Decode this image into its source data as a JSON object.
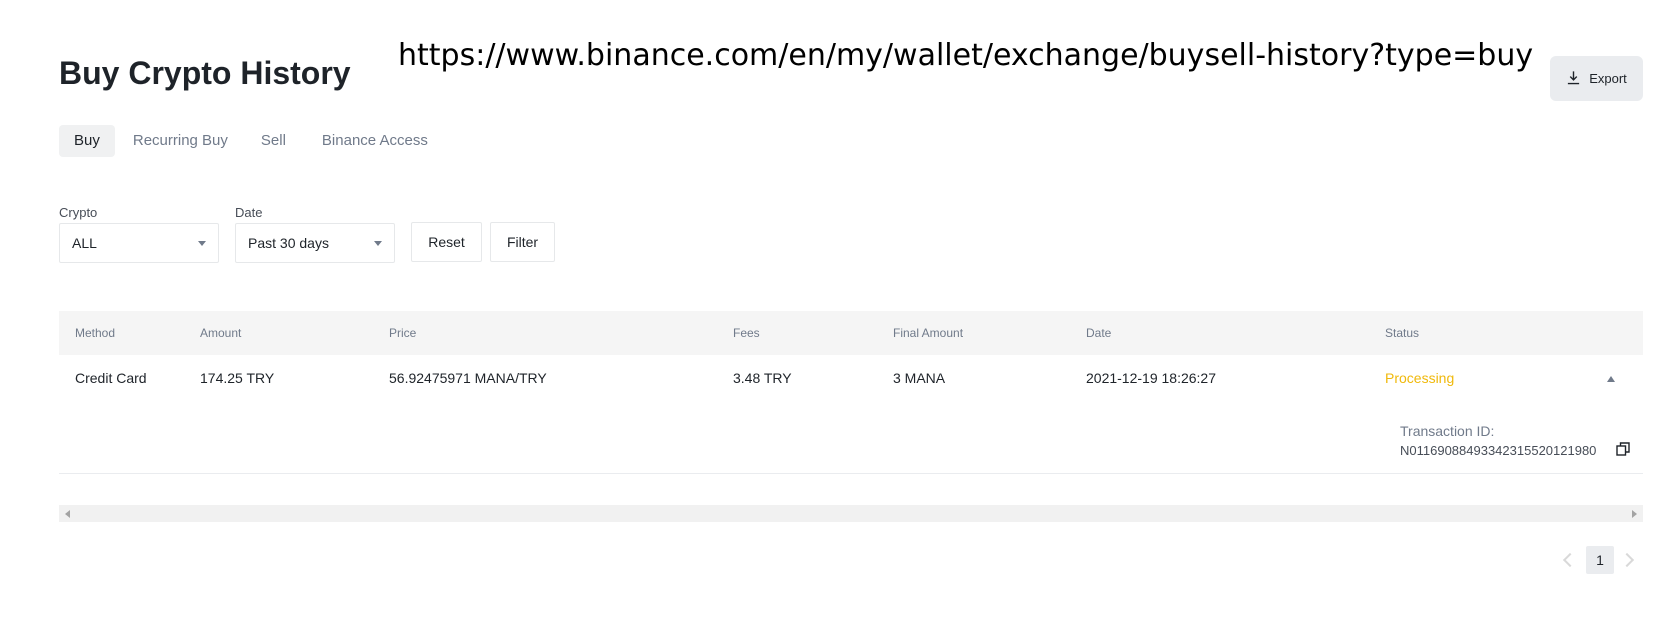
{
  "header": {
    "title": "Buy Crypto History",
    "url_overlay": "https://www.binance.com/en/my/wallet/exchange/buysell-history?type=buy",
    "export_label": "Export",
    "export_icon": "download-icon"
  },
  "tabs": [
    {
      "label": "Buy",
      "active": true
    },
    {
      "label": "Recurring Buy",
      "active": false
    },
    {
      "label": "Sell",
      "active": false
    },
    {
      "label": "Binance Access",
      "active": false
    }
  ],
  "filters": {
    "crypto_label": "Crypto",
    "crypto_value": "ALL",
    "date_label": "Date",
    "date_value": "Past 30 days",
    "reset_label": "Reset",
    "filter_label": "Filter"
  },
  "table": {
    "columns": [
      "Method",
      "Amount",
      "Price",
      "Fees",
      "Final Amount",
      "Date",
      "Status"
    ],
    "rows": [
      {
        "method": "Credit Card",
        "amount": "174.25 TRY",
        "price": "56.92475971 MANA/TRY",
        "fees": "3.48 TRY",
        "final_amount": "3 MANA",
        "date": "2021-12-19 18:26:27",
        "status": "Processing",
        "status_color": "#f0b90b",
        "transaction_id_label": "Transaction ID:",
        "transaction_id": "N01169088493342315520121980"
      }
    ]
  },
  "pagination": {
    "current_page": "1"
  }
}
